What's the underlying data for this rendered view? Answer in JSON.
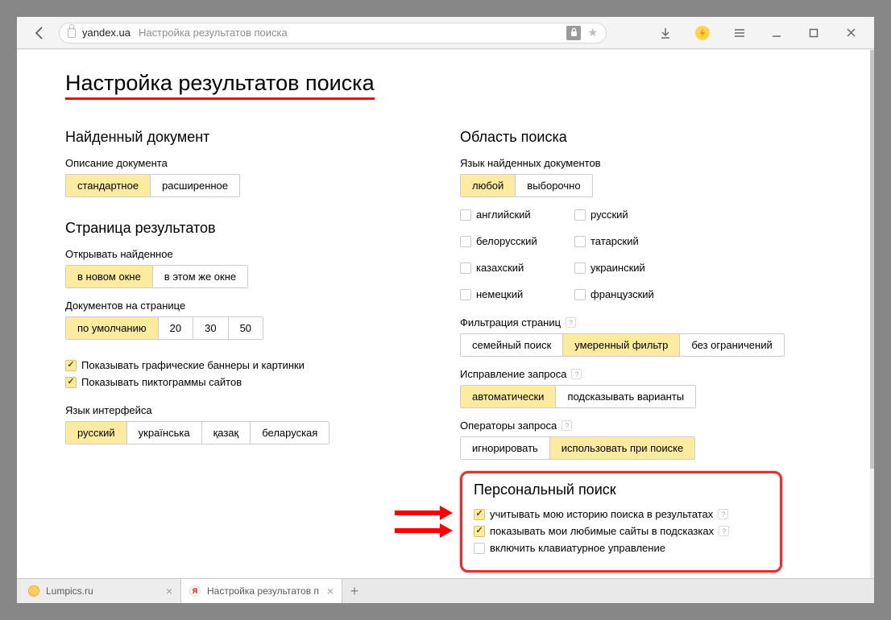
{
  "chrome": {
    "host": "yandex.ua",
    "title": "Настройка результатов поиска"
  },
  "page": {
    "h1": "Настройка результатов поиска",
    "left": {
      "found_doc": {
        "title": "Найденный документ",
        "desc_label": "Описание документа",
        "options": [
          "стандартное",
          "расширенное"
        ],
        "active": 0
      },
      "results_page": {
        "title": "Страница результатов",
        "open_label": "Открывать найденное",
        "open_options": [
          "в новом окне",
          "в этом же окне"
        ],
        "open_active": 0,
        "perpage_label": "Документов на странице",
        "perpage_options": [
          "по умолчанию",
          "20",
          "30",
          "50"
        ],
        "perpage_active": 0,
        "chk_banners": "Показывать графические баннеры и картинки",
        "chk_favicons": "Показывать пиктограммы сайтов"
      },
      "ui_lang": {
        "label": "Язык интерфейса",
        "options": [
          "русский",
          "українська",
          "қазақ",
          "беларуская"
        ],
        "active": 0
      }
    },
    "right": {
      "search_area": {
        "title": "Область поиска",
        "docs_lang_label": "Язык найденных документов",
        "docs_lang_options": [
          "любой",
          "выборочно"
        ],
        "docs_lang_active": 0,
        "langs": [
          "английский",
          "белорусский",
          "казахский",
          "немецкий",
          "русский",
          "татарский",
          "украинский",
          "французский"
        ]
      },
      "filter": {
        "label": "Фильтрация страниц",
        "options": [
          "семейный поиск",
          "умеренный фильтр",
          "без ограничений"
        ],
        "active": 1
      },
      "correction": {
        "label": "Исправление запроса",
        "options": [
          "автоматически",
          "подсказывать варианты"
        ],
        "active": 0
      },
      "operators": {
        "label": "Операторы запроса",
        "options": [
          "игнорировать",
          "использовать при поиске"
        ],
        "active": 1
      },
      "personal": {
        "title": "Персональный поиск",
        "chk_history": "учитывать мою историю поиска в результатах",
        "chk_fav": "показывать мои любимые сайты в подсказках",
        "chk_kbd": "включить клавиатурное управление"
      }
    }
  },
  "tabs": {
    "t1": "Lumpics.ru",
    "t2": "Настройка результатов п",
    "y": "Я"
  }
}
